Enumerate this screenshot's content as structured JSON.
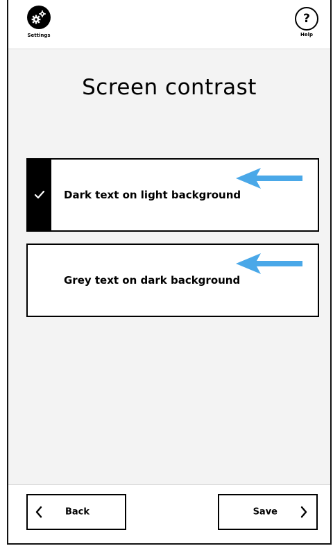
{
  "header": {
    "settings_label": "Settings",
    "settings_icon": "gears-icon",
    "help_label": "Help",
    "help_glyph": "?"
  },
  "page": {
    "title": "Screen contrast"
  },
  "options": [
    {
      "label": "Dark text on light background",
      "selected": true
    },
    {
      "label": "Grey text on dark background",
      "selected": false
    }
  ],
  "footer": {
    "back_label": "Back",
    "save_label": "Save"
  },
  "colors": {
    "arrow": "#4aa8e8",
    "panel_bg": "#f3f3f3",
    "selected_strip": "#000000"
  }
}
